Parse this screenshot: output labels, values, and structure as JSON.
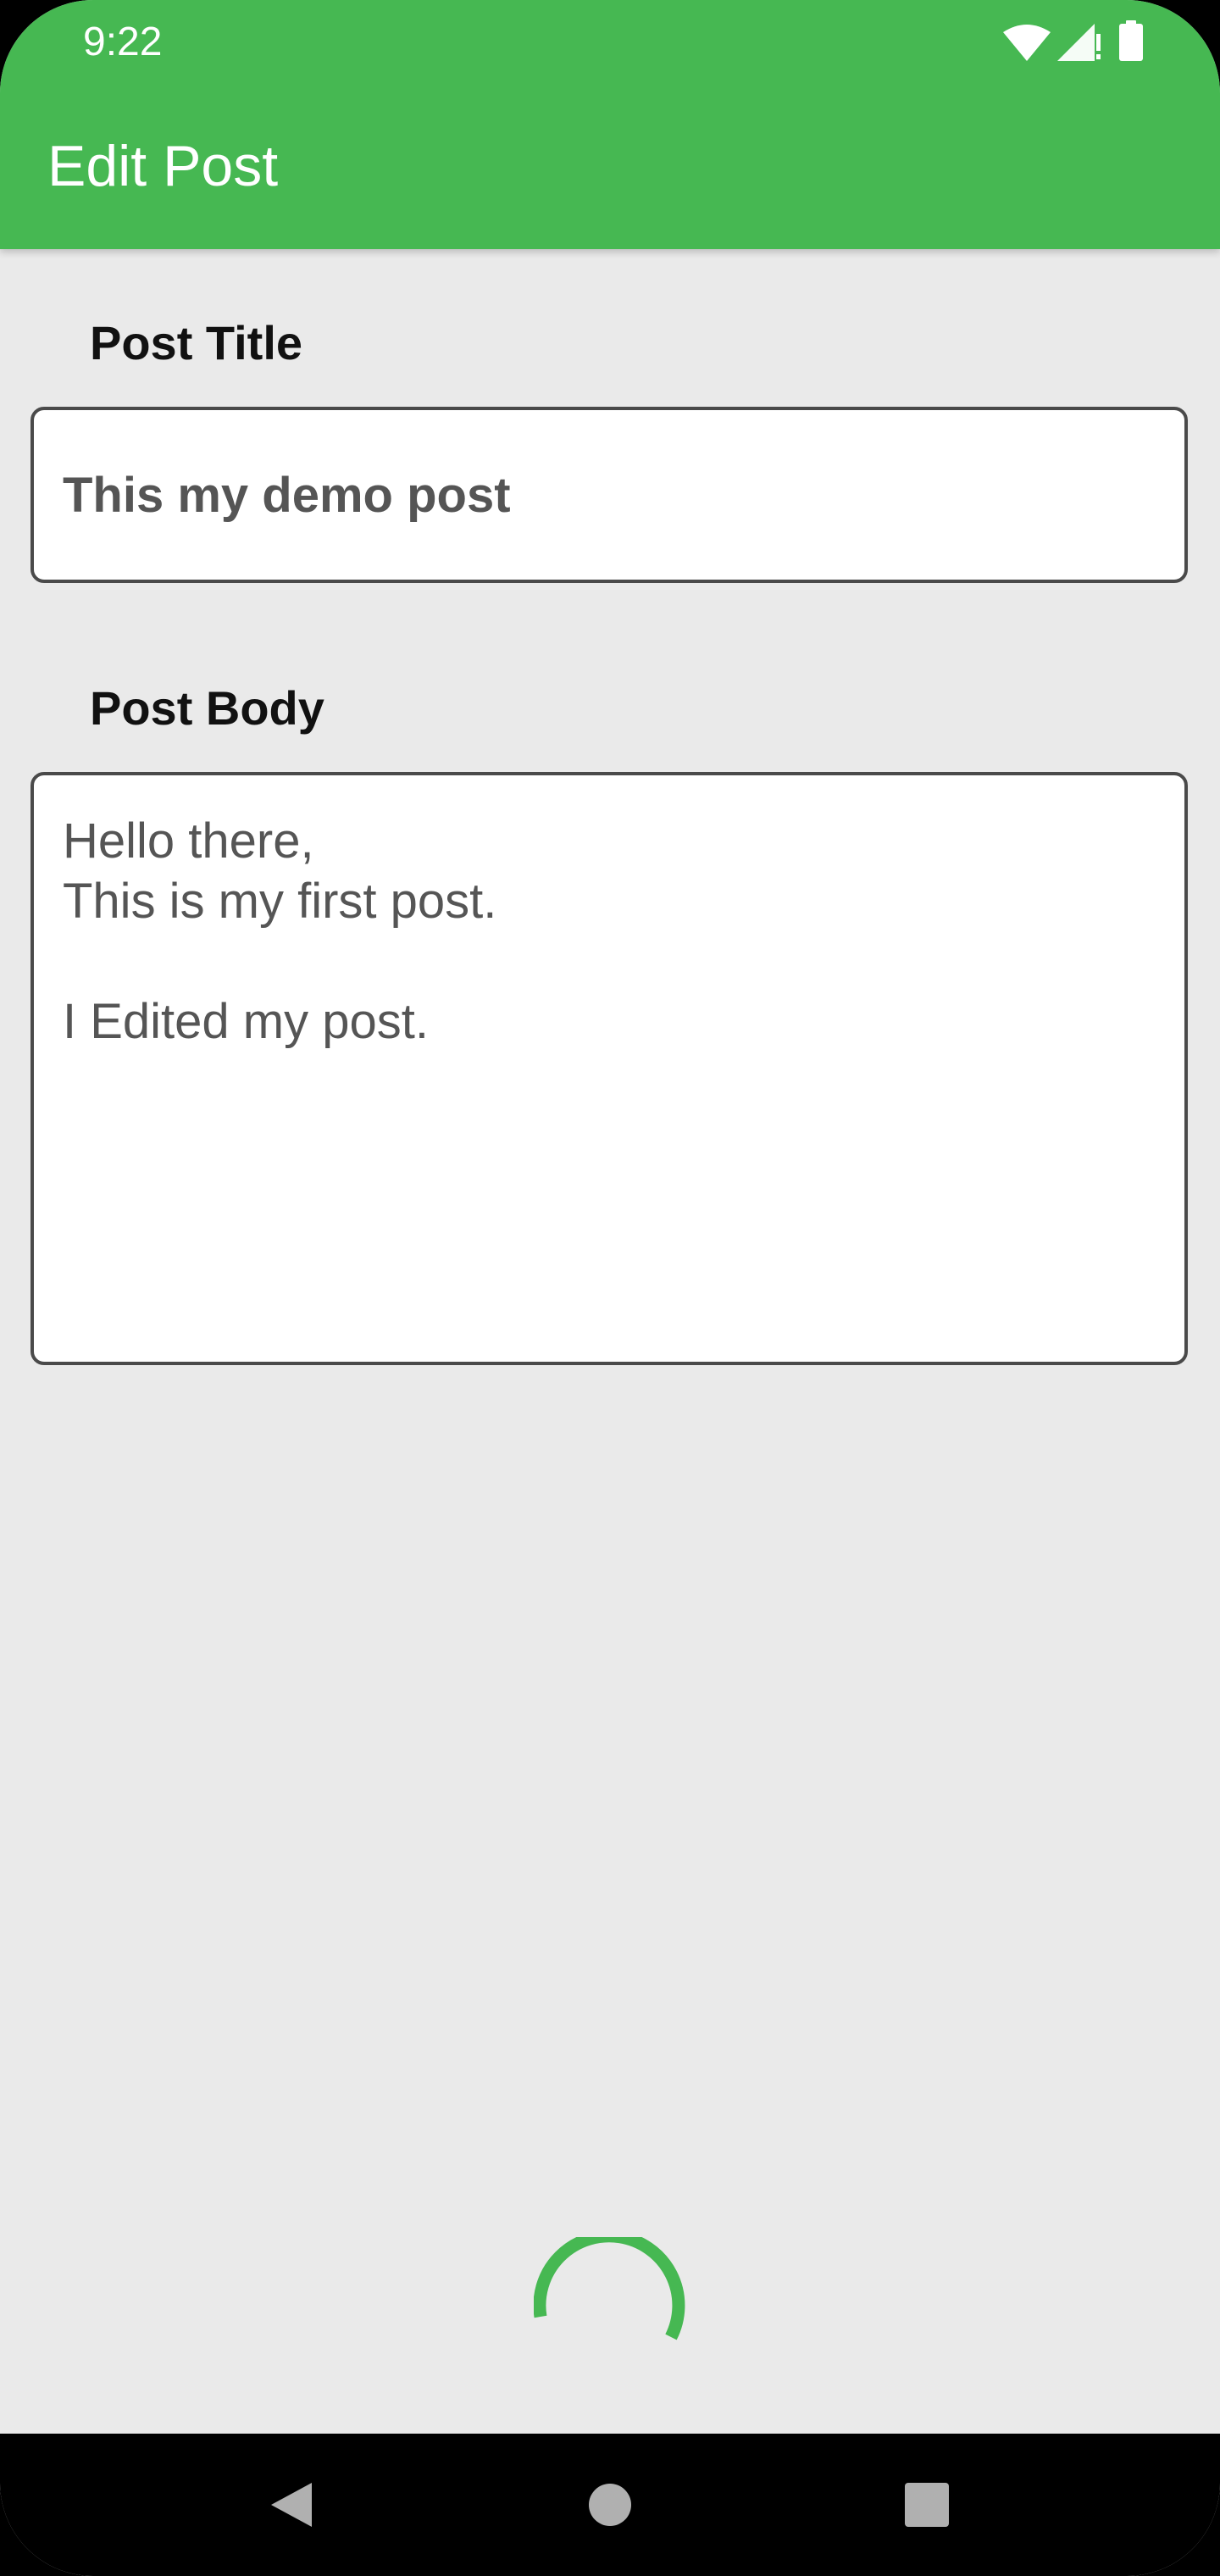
{
  "status_bar": {
    "time": "9:22",
    "icons": [
      "wifi-icon",
      "cell-signal-icon",
      "battery-icon"
    ]
  },
  "app_bar": {
    "title": "Edit Post",
    "color": "#46b852"
  },
  "form": {
    "title_label": "Post Title",
    "title_value": "This my demo post",
    "body_label": "Post Body",
    "body_value": "Hello there,\nThis is my first post.\n\nI Edited my post."
  },
  "loading": {
    "indicator": "circular-progress",
    "color": "#46b852"
  },
  "nav_bar": {
    "buttons": [
      "back-icon",
      "home-icon",
      "recents-icon"
    ]
  }
}
